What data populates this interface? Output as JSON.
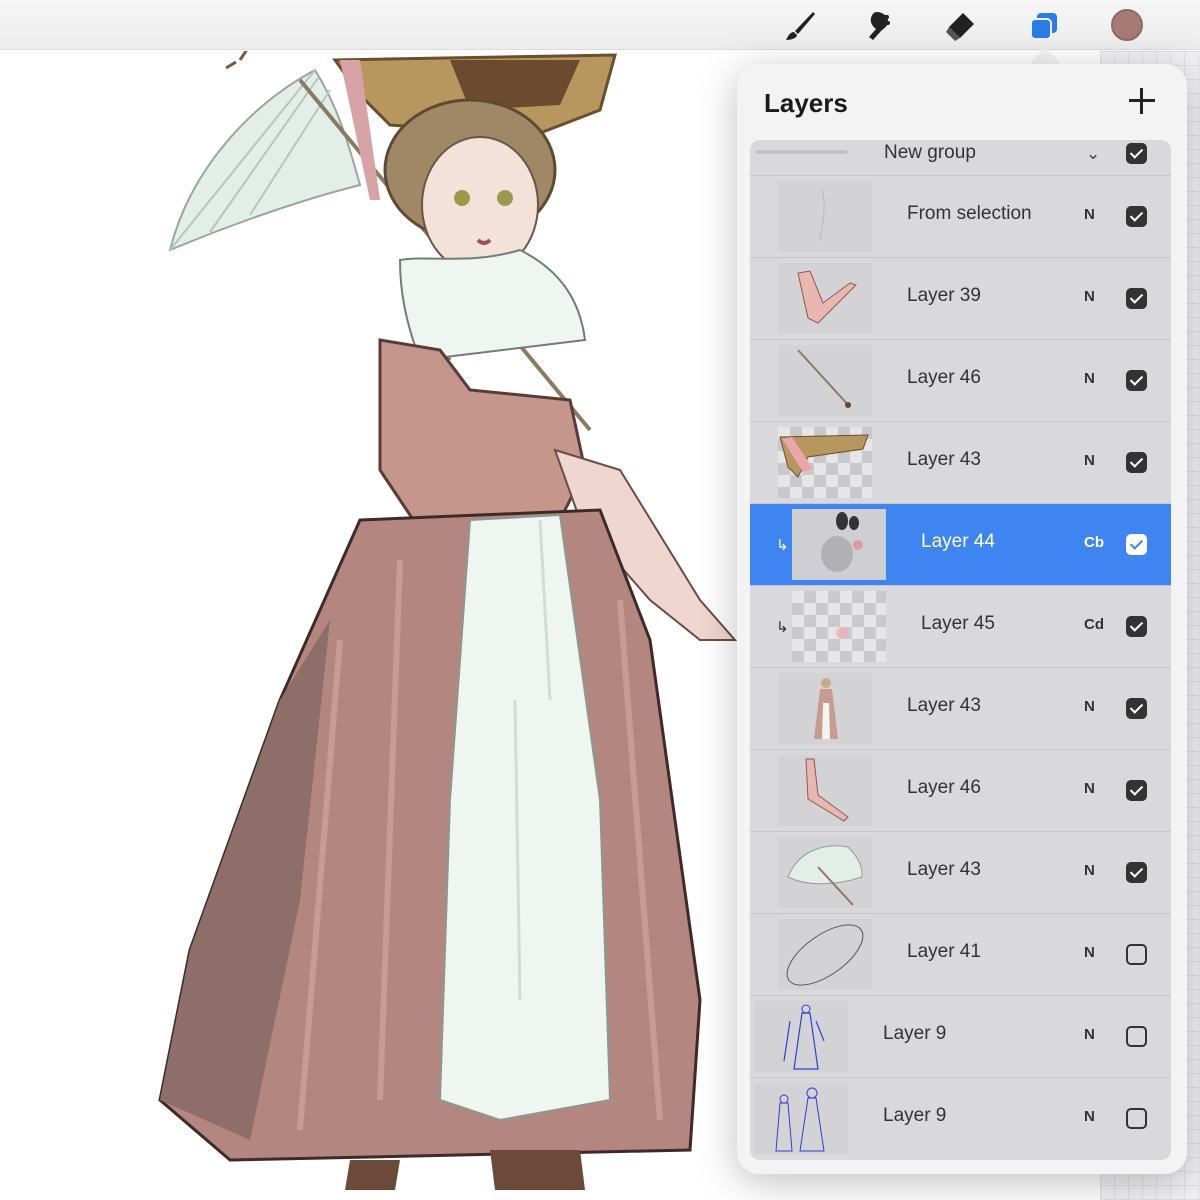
{
  "toolbar": {
    "tools": [
      "brush-icon",
      "smudge-icon",
      "eraser-icon",
      "layers-icon"
    ],
    "active_tool": "layers-icon",
    "current_color": "#a77a74"
  },
  "layers_panel": {
    "title": "Layers",
    "group": {
      "label": "New group",
      "visible": true
    },
    "layers": [
      {
        "name": "From selection",
        "blend": "N",
        "visible": true
      },
      {
        "name": "Layer 39",
        "blend": "N",
        "visible": true
      },
      {
        "name": "Layer 46",
        "blend": "N",
        "visible": true
      },
      {
        "name": "Layer 43",
        "blend": "N",
        "visible": true
      },
      {
        "name": "Layer 44",
        "blend": "Cb",
        "visible": true,
        "selected": true,
        "clipping": true
      },
      {
        "name": "Layer 45",
        "blend": "Cd",
        "visible": true,
        "clipping": true
      },
      {
        "name": "Layer 43",
        "blend": "N",
        "visible": true
      },
      {
        "name": "Layer 46",
        "blend": "N",
        "visible": true
      },
      {
        "name": "Layer 43",
        "blend": "N",
        "visible": true
      },
      {
        "name": "Layer 41",
        "blend": "N",
        "visible": false
      },
      {
        "name": "Layer 9",
        "blend": "N",
        "visible": false
      },
      {
        "name": "Layer 9",
        "blend": "N",
        "visible": false
      }
    ]
  },
  "colors": {
    "selection": "#3f85f1",
    "dress": "#b88a82",
    "apron": "#eef6ef",
    "umbrella": "#dfeae4",
    "hat": "#b8975f"
  }
}
